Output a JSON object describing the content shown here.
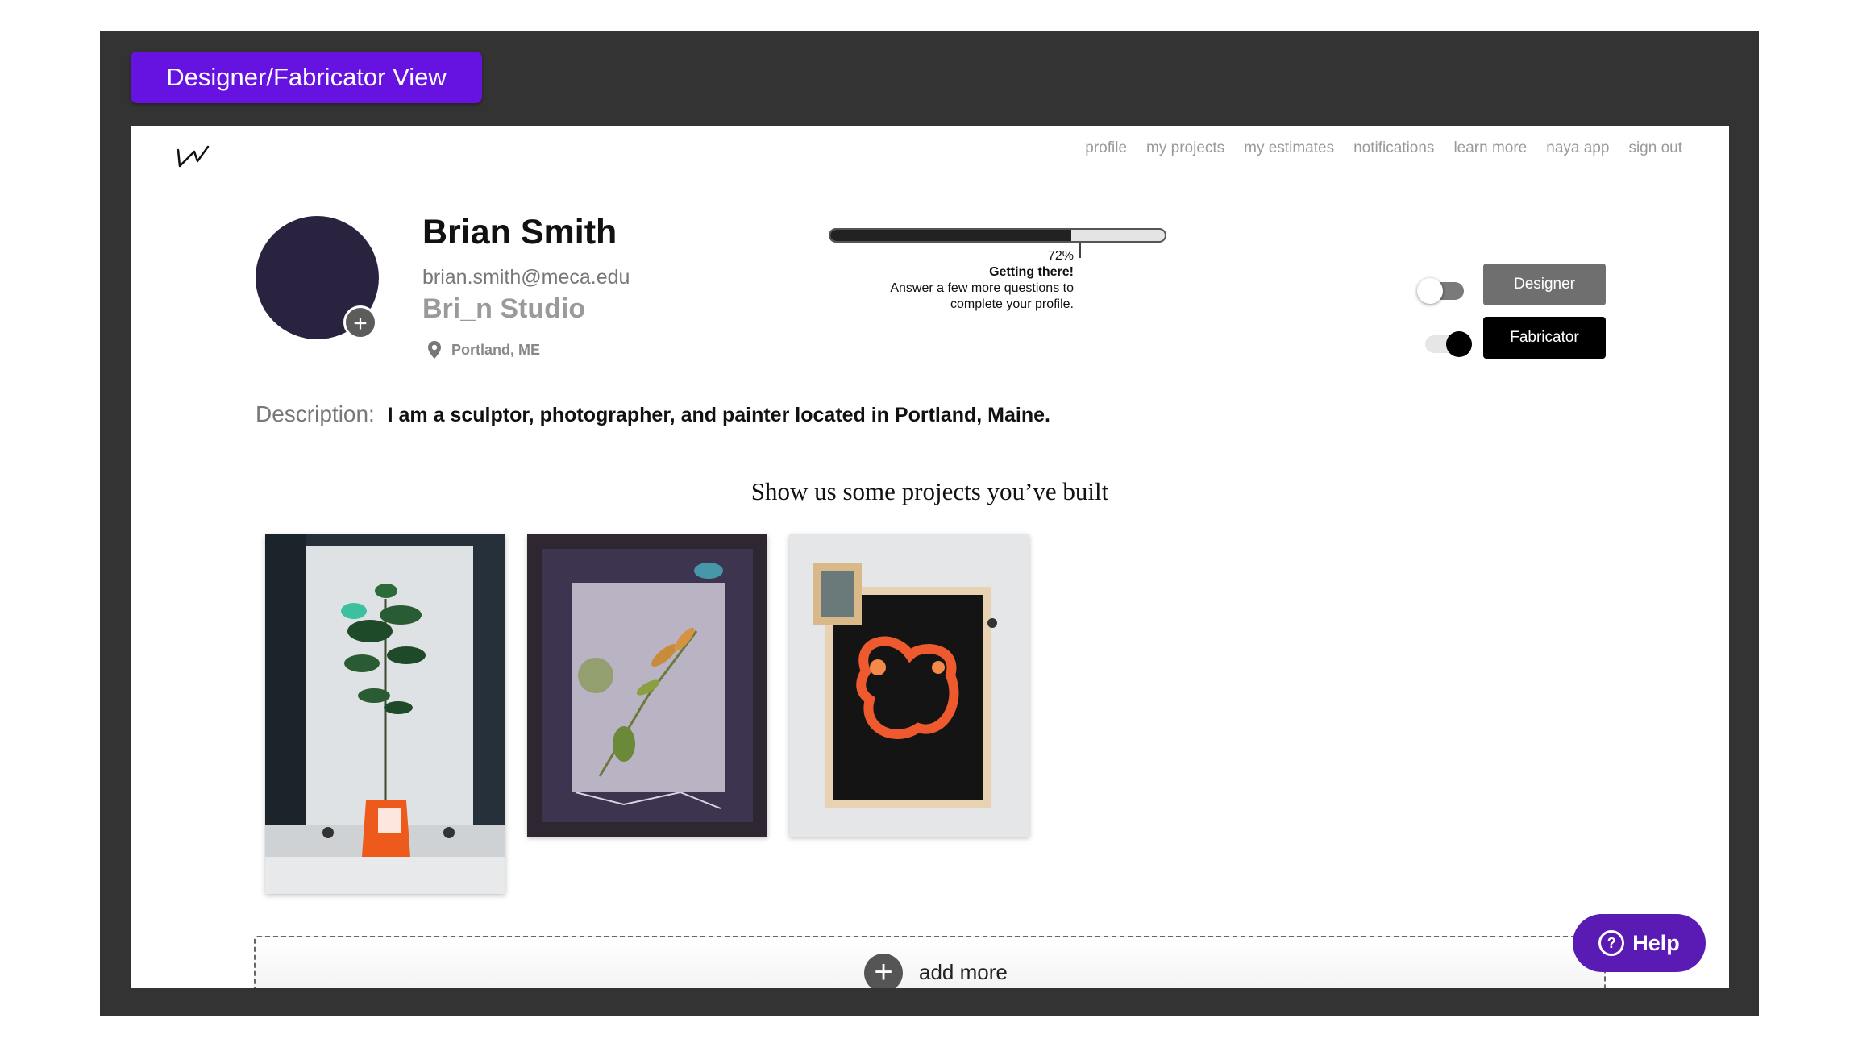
{
  "header": {
    "view_label": "Designer/Fabricator View"
  },
  "nav": {
    "items": [
      "profile",
      "my projects",
      "my estimates",
      "notifications",
      "learn more",
      "naya app",
      "sign out"
    ]
  },
  "profile": {
    "name": "Brian Smith",
    "email": "brian.smith@meca.edu",
    "studio": "Bri_n Studio",
    "location": "Portland, ME",
    "avatar_color": "#2a2340"
  },
  "progress": {
    "percent": 72,
    "percent_label": "72%",
    "heading": "Getting there!",
    "line1": "Answer a few more questions to",
    "line2": "complete your profile."
  },
  "roles": {
    "designer_label": "Designer",
    "designer_enabled": false,
    "fabricator_label": "Fabricator",
    "fabricator_enabled": true
  },
  "description": {
    "label": "Description:",
    "text": "I am a sculptor, photographer, and painter located in Portland, Maine."
  },
  "projects": {
    "heading": "Show us some projects you’ve built",
    "add_more_label": "add more"
  },
  "help": {
    "label": "Help"
  },
  "colors": {
    "accent": "#6612e0",
    "help": "#5a1bb5",
    "frame": "#333333"
  }
}
